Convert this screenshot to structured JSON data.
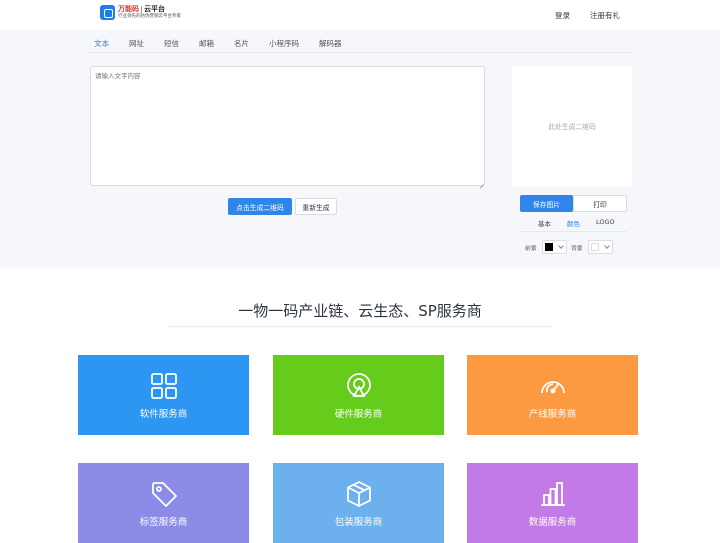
{
  "header": {
    "logo": {
      "brand": "万能码",
      "cloud": "云平台",
      "slogan": "行业领先的防伪营销云平台专家"
    },
    "login_label": "登录",
    "register_label": "注册有礼"
  },
  "tabs": [
    {
      "label": "文本",
      "active": true
    },
    {
      "label": "网址",
      "active": false
    },
    {
      "label": "短信",
      "active": false
    },
    {
      "label": "邮箱",
      "active": false
    },
    {
      "label": "名片",
      "active": false
    },
    {
      "label": "小程序码",
      "active": false
    },
    {
      "label": "解码器",
      "active": false
    }
  ],
  "editor": {
    "placeholder": "请输入文字内容",
    "generate_label": "点击生成二维码",
    "regenerate_label": "重新生成"
  },
  "qr_panel": {
    "placeholder_text": "此处生成二维码",
    "save_label": "保存图片",
    "print_label": "打印",
    "style_tabs": [
      {
        "label": "基本",
        "active": false
      },
      {
        "label": "颜色",
        "active": true
      },
      {
        "label": "LOGO",
        "active": false
      }
    ],
    "foreground_label": "前景",
    "foreground_color": "#000000",
    "background_label": "背景",
    "background_color": "#ffffff"
  },
  "section": {
    "title": "一物一码产业链、云生态、SP服务商"
  },
  "cards": [
    {
      "label": "软件服务商",
      "color": "#2d95f2",
      "icon": "grid-icon"
    },
    {
      "label": "硬件服务商",
      "color": "#66cc1c",
      "icon": "scanner-icon"
    },
    {
      "label": "产线服务商",
      "color": "#fb9a40",
      "icon": "gauge-icon"
    },
    {
      "label": "标签服务商",
      "color": "#8c8ce8",
      "icon": "tag-icon"
    },
    {
      "label": "包装服务商",
      "color": "#6cb1ee",
      "icon": "box-icon"
    },
    {
      "label": "数据服务商",
      "color": "#c27ae6",
      "icon": "bar-chart-icon"
    }
  ]
}
